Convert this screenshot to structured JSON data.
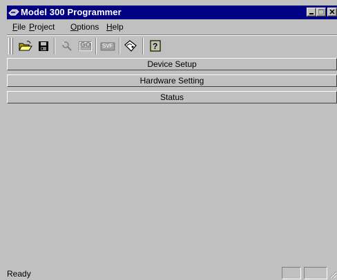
{
  "window": {
    "title": "Model 300 Programmer"
  },
  "menu": {
    "items": [
      {
        "label_u": "F",
        "label_rest": "ile"
      },
      {
        "label_u": "P",
        "label_rest": "roject"
      },
      {
        "label_u": "O",
        "label_rest": "ptions"
      },
      {
        "label_u": "H",
        "label_rest": "elp"
      }
    ]
  },
  "toolbar": {
    "go_label": "GO",
    "svf_label": "SVF"
  },
  "panels": {
    "device_setup": "Device Setup",
    "hardware_setting": "Hardware Setting",
    "status": "Status"
  },
  "statusbar": {
    "text": "Ready"
  }
}
